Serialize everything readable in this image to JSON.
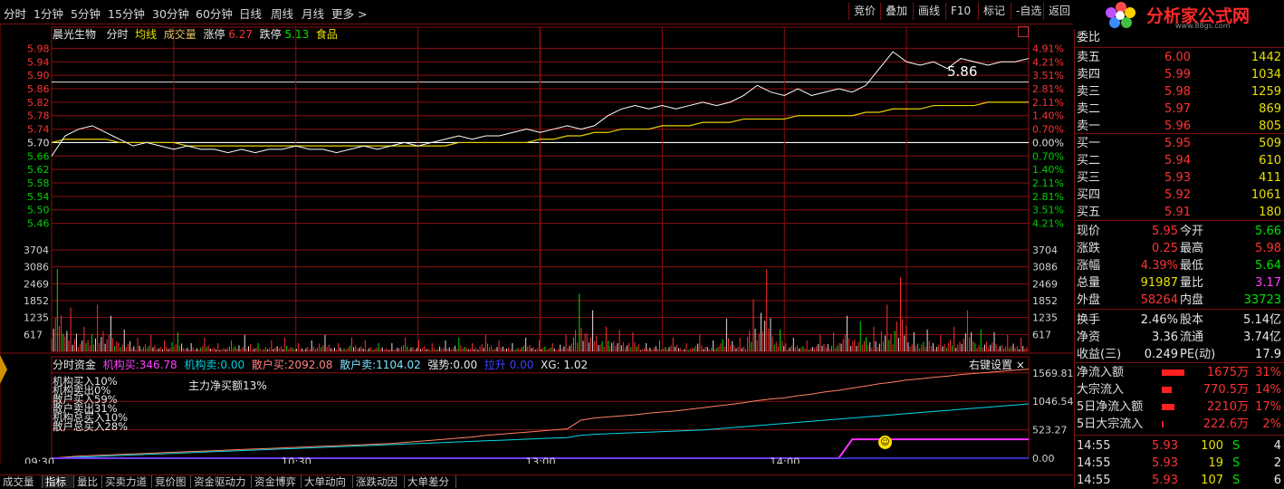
{
  "toolbar": {
    "periods": [
      "分时",
      "1分钟",
      "5分钟",
      "15分钟",
      "30分钟",
      "60分钟",
      "日线",
      "周线",
      "月线",
      "更多 >"
    ],
    "right_buttons": [
      "竞价",
      "叠加",
      "画线",
      "F10",
      "标记",
      "-自选",
      "返回"
    ]
  },
  "logo": {
    "main": "分析家公式网",
    "url": "www.88gs.com"
  },
  "header": {
    "stock": "晨光生物",
    "mode": "分时",
    "avg_label": "均线",
    "vol_label": "成交量",
    "limit_up_label": "涨停",
    "limit_up": "6.27",
    "limit_down_label": "跌停",
    "limit_down": "5.13",
    "sector": "食品"
  },
  "price_axis": {
    "left": [
      "5.98",
      "5.94",
      "5.90",
      "5.86",
      "5.82",
      "5.78",
      "5.74",
      "5.70",
      "5.66",
      "5.62",
      "5.58",
      "5.54",
      "5.50",
      "5.46"
    ],
    "right": [
      "4.91%",
      "4.21%",
      "3.51%",
      "2.81%",
      "2.11%",
      "1.40%",
      "0.70%",
      "0.00%",
      "0.70%",
      "1.40%",
      "2.11%",
      "2.81%",
      "3.51%",
      "4.21%"
    ]
  },
  "volume_axis": [
    "3704",
    "3086",
    "2469",
    "1852",
    "1235",
    "617"
  ],
  "price_annotation": "5.86",
  "fund_bar": {
    "title": "分时资金",
    "inst_buy_label": "机构买:",
    "inst_buy": "346.78",
    "inst_sell_label": "机构卖:",
    "inst_sell": "0.00",
    "ret_buy_label": "散户买:",
    "ret_buy": "2092.08",
    "ret_sell_label": "散户卖:",
    "ret_sell": "1104.02",
    "strength_label": "强势:",
    "strength": "0.00",
    "pull_label": "拉升",
    "pull": "0.00",
    "xg_label": "XG:",
    "xg": "1.02",
    "settings": "右键设置 ×"
  },
  "fund_notes": [
    "机构买入10%",
    "机构卖出0%",
    "散户买入59%",
    "散户卖出31%",
    "机构总买入10%",
    "散户总买入28%"
  ],
  "main_net": "主力净买额13%",
  "fund_axis": [
    "1569.81",
    "1046.54",
    "523.27",
    "0.00"
  ],
  "time_axis": [
    "09:30",
    "10:30",
    "13:00",
    "14:00"
  ],
  "bottom_tabs": [
    "成交量",
    "指标",
    "量比",
    "买卖力道",
    "竞价图",
    "资金驱动力",
    "资金博弈",
    "大单动向",
    "涨跌动因",
    "大单差分"
  ],
  "quote": {
    "weibi_label": "委比",
    "asks": [
      {
        "label": "卖五",
        "price": "6.00",
        "vol": "1442"
      },
      {
        "label": "卖四",
        "price": "5.99",
        "vol": "1034"
      },
      {
        "label": "卖三",
        "price": "5.98",
        "vol": "1259"
      },
      {
        "label": "卖二",
        "price": "5.97",
        "vol": "869"
      },
      {
        "label": "卖一",
        "price": "5.96",
        "vol": "805"
      }
    ],
    "bids": [
      {
        "label": "买一",
        "price": "5.95",
        "vol": "509"
      },
      {
        "label": "买二",
        "price": "5.94",
        "vol": "610"
      },
      {
        "label": "买三",
        "price": "5.93",
        "vol": "411"
      },
      {
        "label": "买四",
        "price": "5.92",
        "vol": "1061"
      },
      {
        "label": "买五",
        "price": "5.91",
        "vol": "180"
      }
    ],
    "stats": [
      {
        "l1": "现价",
        "v1": "5.95",
        "c1": "red",
        "l2": "今开",
        "v2": "5.66",
        "c2": "grn"
      },
      {
        "l1": "涨跌",
        "v1": "0.25",
        "c1": "red",
        "l2": "最高",
        "v2": "5.98",
        "c2": "red"
      },
      {
        "l1": "涨幅",
        "v1": "4.39%",
        "c1": "red",
        "l2": "最低",
        "v2": "5.64",
        "c2": "grn"
      },
      {
        "l1": "总量",
        "v1": "91987",
        "c1": "yel",
        "l2": "量比",
        "v2": "3.17",
        "c2": "mag"
      },
      {
        "l1": "外盘",
        "v1": "58264",
        "c1": "red",
        "l2": "内盘",
        "v2": "33723",
        "c2": "grn"
      }
    ],
    "stats2": [
      {
        "l1": "换手",
        "v1": "2.46%",
        "l2": "股本",
        "v2": "5.14亿"
      },
      {
        "l1": "净资",
        "v1": "3.36",
        "l2": "流通",
        "v2": "3.74亿"
      },
      {
        "l1": "收益(三)",
        "v1": "0.249",
        "l2": "PE(动)",
        "v2": "17.9"
      }
    ],
    "flows": [
      {
        "label": "净流入额",
        "value": "1675万",
        "pct": "31%",
        "bar": 0.31
      },
      {
        "label": "大宗流入",
        "value": "770.5万",
        "pct": "14%",
        "bar": 0.14
      },
      {
        "label": "5日净流入额",
        "value": "2210万",
        "pct": "17%",
        "bar": 0.17
      },
      {
        "label": "5日大宗流入",
        "value": "222.6万",
        "pct": "2%",
        "bar": 0.02
      }
    ],
    "ticks": [
      {
        "time": "14:55",
        "price": "5.93",
        "vol": "100",
        "side": "S",
        "n": "4"
      },
      {
        "time": "14:55",
        "price": "5.93",
        "vol": "19",
        "side": "S",
        "n": "2"
      },
      {
        "time": "14:55",
        "price": "5.93",
        "vol": "107",
        "side": "S",
        "n": "6"
      }
    ]
  },
  "chart_data": {
    "type": "line",
    "prev_close": 5.7,
    "ylim": [
      5.44,
      6.0
    ],
    "price": [
      5.66,
      5.72,
      5.74,
      5.75,
      5.73,
      5.71,
      5.69,
      5.7,
      5.69,
      5.68,
      5.69,
      5.68,
      5.68,
      5.67,
      5.68,
      5.67,
      5.68,
      5.68,
      5.69,
      5.68,
      5.68,
      5.67,
      5.68,
      5.69,
      5.68,
      5.69,
      5.7,
      5.69,
      5.7,
      5.71,
      5.72,
      5.71,
      5.72,
      5.72,
      5.73,
      5.74,
      5.73,
      5.74,
      5.75,
      5.74,
      5.75,
      5.78,
      5.8,
      5.81,
      5.8,
      5.81,
      5.8,
      5.81,
      5.82,
      5.81,
      5.82,
      5.84,
      5.87,
      5.85,
      5.84,
      5.86,
      5.84,
      5.85,
      5.86,
      5.85,
      5.87,
      5.92,
      5.97,
      5.94,
      5.93,
      5.94,
      5.92,
      5.95,
      5.94,
      5.93,
      5.94,
      5.94,
      5.95
    ],
    "avg": [
      5.7,
      5.71,
      5.71,
      5.71,
      5.71,
      5.7,
      5.7,
      5.7,
      5.7,
      5.7,
      5.69,
      5.69,
      5.69,
      5.69,
      5.69,
      5.69,
      5.69,
      5.69,
      5.69,
      5.69,
      5.69,
      5.69,
      5.69,
      5.69,
      5.69,
      5.69,
      5.69,
      5.69,
      5.69,
      5.69,
      5.7,
      5.7,
      5.7,
      5.7,
      5.7,
      5.7,
      5.71,
      5.71,
      5.72,
      5.72,
      5.73,
      5.73,
      5.74,
      5.74,
      5.74,
      5.75,
      5.75,
      5.75,
      5.76,
      5.76,
      5.76,
      5.77,
      5.77,
      5.77,
      5.77,
      5.78,
      5.78,
      5.78,
      5.78,
      5.78,
      5.79,
      5.79,
      5.8,
      5.8,
      5.8,
      5.81,
      5.81,
      5.81,
      5.81,
      5.82,
      5.82,
      5.82,
      5.82
    ],
    "volume": [
      3000,
      1600,
      900,
      1700,
      1300,
      800,
      500,
      600,
      400,
      700,
      300,
      500,
      300,
      400,
      600,
      300,
      400,
      500,
      300,
      400,
      600,
      300,
      500,
      400,
      300,
      300,
      500,
      400,
      300,
      400,
      500,
      300,
      600,
      400,
      300,
      500,
      400,
      300,
      600,
      2100,
      1500,
      900,
      800,
      700,
      300,
      400,
      500,
      300,
      600,
      400,
      1200,
      500,
      1900,
      3000,
      800,
      500,
      400,
      600,
      700,
      1300,
      1100,
      900,
      1700,
      2700,
      700,
      800,
      600,
      900,
      1500,
      800,
      700,
      600,
      500
    ],
    "vol_max": 3704,
    "fund_max": 1700,
    "fund_red": [
      0,
      20,
      40,
      50,
      60,
      70,
      80,
      90,
      100,
      110,
      120,
      130,
      140,
      150,
      160,
      170,
      180,
      190,
      200,
      210,
      220,
      230,
      240,
      250,
      260,
      270,
      290,
      310,
      330,
      350,
      370,
      390,
      420,
      440,
      460,
      480,
      500,
      520,
      540,
      700,
      740,
      760,
      780,
      800,
      830,
      850,
      870,
      900,
      930,
      960,
      990,
      1020,
      1060,
      1090,
      1110,
      1150,
      1180,
      1220,
      1250,
      1290,
      1330,
      1370,
      1400,
      1440,
      1460,
      1490,
      1510,
      1540,
      1560,
      1580,
      1600,
      1620,
      1640
    ],
    "fund_cyan": [
      0,
      10,
      20,
      30,
      40,
      50,
      60,
      70,
      80,
      90,
      100,
      110,
      120,
      130,
      140,
      150,
      160,
      170,
      180,
      190,
      200,
      210,
      220,
      230,
      240,
      250,
      260,
      270,
      280,
      290,
      300,
      310,
      320,
      330,
      340,
      350,
      360,
      370,
      380,
      420,
      440,
      450,
      460,
      470,
      480,
      490,
      500,
      510,
      520,
      540,
      560,
      580,
      600,
      620,
      640,
      660,
      680,
      700,
      720,
      740,
      760,
      780,
      800,
      820,
      840,
      860,
      880,
      900,
      920,
      940,
      960,
      980,
      1000
    ],
    "fund_mag": [
      0,
      0,
      0,
      0,
      0,
      0,
      0,
      0,
      0,
      0,
      0,
      0,
      0,
      0,
      0,
      0,
      0,
      0,
      0,
      0,
      0,
      0,
      0,
      0,
      0,
      0,
      0,
      0,
      0,
      0,
      0,
      0,
      0,
      0,
      0,
      0,
      0,
      0,
      0,
      0,
      0,
      0,
      0,
      0,
      0,
      0,
      0,
      0,
      0,
      0,
      0,
      0,
      0,
      0,
      0,
      0,
      0,
      0,
      0,
      347,
      347,
      347,
      347,
      347,
      347,
      347,
      347,
      347,
      347,
      347,
      347,
      347,
      347
    ]
  }
}
